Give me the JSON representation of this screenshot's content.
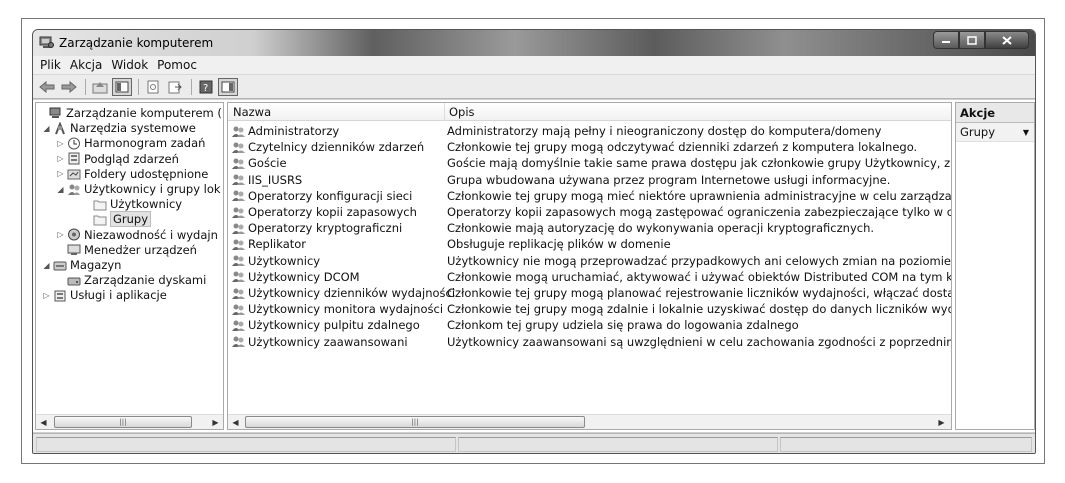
{
  "window": {
    "title": "Zarządzanie komputerem"
  },
  "menu": [
    "Plik",
    "Akcja",
    "Widok",
    "Pomoc"
  ],
  "toolbar": {
    "buttons": [
      "back-arrow",
      "forward-arrow",
      "up-folder",
      "show-hide-console-tree",
      "export-list",
      "refresh",
      "export",
      "help",
      "show-hide-action-pane"
    ]
  },
  "tree": {
    "items": [
      {
        "label": "Zarządzanie komputerem (loka",
        "icon": "computer-management-icon",
        "toggle": "",
        "level": 0
      },
      {
        "label": "Narzędzia systemowe",
        "icon": "system-tools-icon",
        "toggle": "◢",
        "level": 1
      },
      {
        "label": "Harmonogram zadań",
        "icon": "clock-icon",
        "toggle": "▷",
        "level": 2
      },
      {
        "label": "Podgląd zdarzeń",
        "icon": "event-viewer-icon",
        "toggle": "▷",
        "level": 2
      },
      {
        "label": "Foldery udostępnione",
        "icon": "shared-folders-icon",
        "toggle": "▷",
        "level": 2
      },
      {
        "label": "Użytkownicy i grupy lok",
        "icon": "users-icon",
        "toggle": "◢",
        "level": 2
      },
      {
        "label": "Użytkownicy",
        "icon": "folder-icon",
        "toggle": "",
        "level": 3
      },
      {
        "label": "Grupy",
        "icon": "folder-icon",
        "toggle": "",
        "level": 3,
        "selected": true
      },
      {
        "label": "Niezawodność i wydajn",
        "icon": "performance-icon",
        "toggle": "▷",
        "level": 2
      },
      {
        "label": "Menedżer urządzeń",
        "icon": "device-manager-icon",
        "toggle": "",
        "level": 2
      },
      {
        "label": "Magazyn",
        "icon": "storage-icon",
        "toggle": "◢",
        "level": 1
      },
      {
        "label": "Zarządzanie dyskami",
        "icon": "disk-icon",
        "toggle": "",
        "level": 2
      },
      {
        "label": "Usługi i aplikacje",
        "icon": "services-icon",
        "toggle": "▷",
        "level": 1
      }
    ],
    "scroll_thumb_glyph": "|||"
  },
  "list": {
    "columns": [
      "Nazwa",
      "Opis"
    ],
    "rows": [
      {
        "name": "Administratorzy",
        "desc": "Administratorzy mają pełny i nieograniczony dostęp do komputera/domeny"
      },
      {
        "name": "Czytelnicy dzienników zdarzeń",
        "desc": "Członkowie tej grupy mogą odczytywać dzienniki zdarzeń z komputera lokalnego."
      },
      {
        "name": "Goście",
        "desc": "Goście mają domyślnie takie same prawa dostępu jak członkowie grupy Użytkownicy, z wyjątkiem konta Gość"
      },
      {
        "name": "IIS_IUSRS",
        "desc": "Grupa wbudowana używana przez program Internetowe usługi informacyjne."
      },
      {
        "name": "Operatorzy konfiguracji sieci",
        "desc": "Członkowie tej grupy mogą mieć niektóre uprawnienia administracyjne w celu zarządzania konfiguracją"
      },
      {
        "name": "Operatorzy kopii zapasowych",
        "desc": "Operatorzy kopii zapasowych mogą zastępować ograniczenia zabezpieczające tylko w celu wykonania"
      },
      {
        "name": "Operatorzy kryptograficzni",
        "desc": "Członkowie mają autoryzację do wykonywania operacji kryptograficznych."
      },
      {
        "name": "Replikator",
        "desc": "Obsługuje replikację plików w domenie"
      },
      {
        "name": "Użytkownicy",
        "desc": "Użytkownicy nie mogą przeprowadzać przypadkowych ani celowych zmian na poziomie całego systemu"
      },
      {
        "name": "Użytkownicy DCOM",
        "desc": "Członkowie mogą uruchamiać, aktywować i używać obiektów Distributed COM na tym komputerze."
      },
      {
        "name": "Użytkownicy dzienników wydajności",
        "desc": "Członkowie tej grupy mogą planować rejestrowanie liczników wydajności, włączać dostawców śledzenia"
      },
      {
        "name": "Użytkownicy monitora wydajności",
        "desc": "Członkowie tej grupy mogą zdalnie i lokalnie uzyskiwać dostęp do danych liczników wydajności"
      },
      {
        "name": "Użytkownicy pulpitu zdalnego",
        "desc": "Członkom tej grupy udziela się prawa do logowania zdalnego"
      },
      {
        "name": "Użytkownicy zaawansowani",
        "desc": "Użytkownicy zaawansowani są uwzględnieni w celu zachowania zgodności z poprzednimi wersjami"
      }
    ],
    "scroll_thumb_glyph": "|||"
  },
  "actions": {
    "title": "Akcje",
    "section": "Grupy",
    "section_arrow": "▼"
  }
}
